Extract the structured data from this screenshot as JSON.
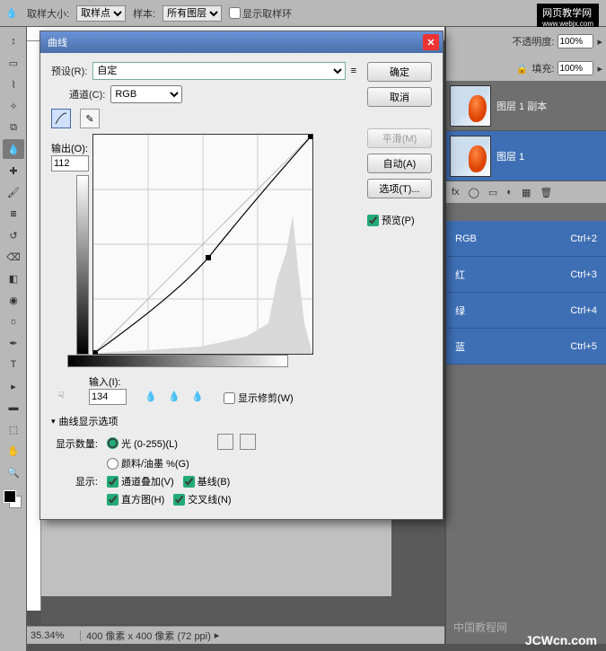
{
  "options_bar": {
    "sample_size_label": "取样大小:",
    "sample_size_value": "取样点",
    "sample_label": "样本:",
    "sample_value": "所有图层",
    "show_ring": "显示取样环"
  },
  "watermarks": {
    "top": "网页教学网",
    "top_sub": "www.webjx.com",
    "mid": "中国教程网",
    "bottom": "JCWcn.com"
  },
  "status": {
    "zoom": "35.34%",
    "doc": "400 像素 x 400 像素 (72 ppi)"
  },
  "panel_opts": {
    "opacity_label": "不透明度:",
    "opacity_val": "100%",
    "fill_label": "填充:",
    "fill_val": "100%"
  },
  "layers": [
    {
      "name": "图层 1 副本",
      "selected": false
    },
    {
      "name": "图层 1",
      "selected": true
    }
  ],
  "channels": [
    {
      "name": "RGB",
      "key": "Ctrl+2"
    },
    {
      "name": "红",
      "key": "Ctrl+3"
    },
    {
      "name": "绿",
      "key": "Ctrl+4"
    },
    {
      "name": "蓝",
      "key": "Ctrl+5"
    }
  ],
  "dialog": {
    "title": "曲线",
    "preset_label": "预设(R):",
    "preset_value": "自定",
    "channel_label": "通道(C):",
    "channel_value": "RGB",
    "output_label": "输出(O):",
    "output_value": "112",
    "input_label": "输入(I):",
    "input_value": "134",
    "show_clip": "显示修剪(W)",
    "disclosure": "曲线显示选项",
    "amount_label": "显示数量:",
    "light": "光 (0-255)(L)",
    "ink": "颜料/油墨 %(G)",
    "show_label": "显示:",
    "overlay": "通道叠加(V)",
    "baseline": "基线(B)",
    "histogram": "直方图(H)",
    "intersection": "交叉线(N)",
    "btn_ok": "确定",
    "btn_cancel": "取消",
    "btn_smooth": "平滑(M)",
    "btn_auto": "自动(A)",
    "btn_options": "选项(T)...",
    "preview": "预览(P)"
  },
  "chart_data": {
    "type": "line",
    "title": "曲线 (RGB)",
    "xlabel": "输入",
    "ylabel": "输出",
    "xlim": [
      0,
      255
    ],
    "ylim": [
      0,
      255
    ],
    "grid": true,
    "series": [
      {
        "name": "baseline",
        "x": [
          0,
          255
        ],
        "y": [
          0,
          255
        ]
      },
      {
        "name": "curve",
        "x": [
          0,
          64,
          134,
          200,
          255
        ],
        "y": [
          0,
          42,
          112,
          190,
          255
        ]
      }
    ],
    "control_point": {
      "input": 134,
      "output": 112
    }
  }
}
